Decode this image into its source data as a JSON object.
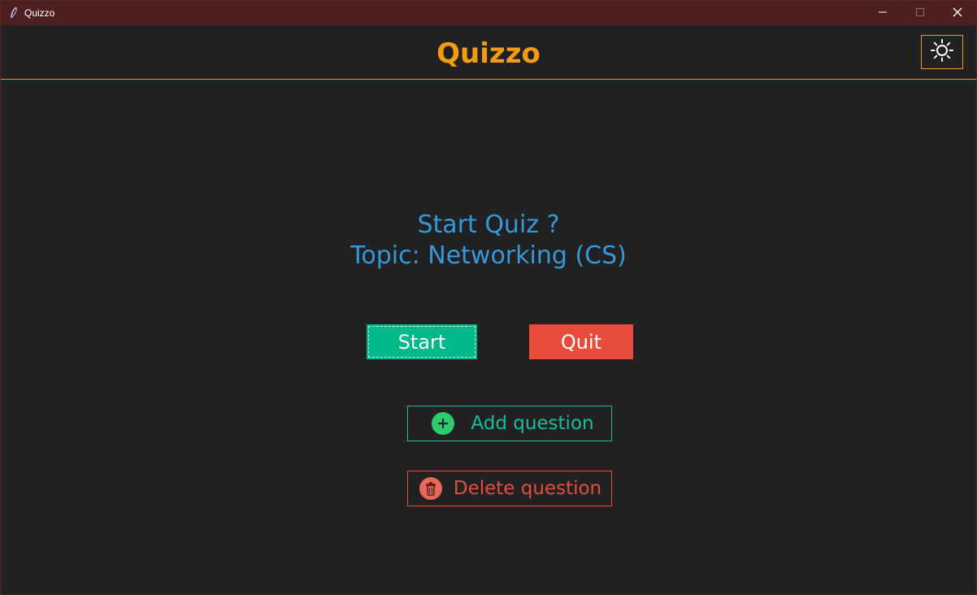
{
  "window": {
    "title": "Quizzo",
    "icon": "feather-icon",
    "controls": [
      "minimize-icon",
      "maximize-icon",
      "close-icon"
    ]
  },
  "header": {
    "title": "Quizzo",
    "theme_toggle_icon": "sun-icon"
  },
  "main": {
    "question": "Start Quiz ?",
    "topic": "Topic: Networking (CS)",
    "start_label": "Start",
    "quit_label": "Quit",
    "add_label": "Add question",
    "add_icon": "plus-circle-icon",
    "delete_label": "Delete question",
    "delete_icon": "trash-icon"
  },
  "colors": {
    "accent": "#f39c12",
    "text_blue": "#3498db",
    "start_green": "#00b98a",
    "quit_red": "#e74c3c",
    "add_teal": "#1abc9c",
    "titlebar": "#4e1f1f",
    "background": "#212121"
  }
}
